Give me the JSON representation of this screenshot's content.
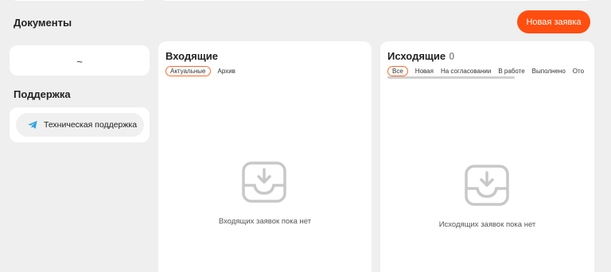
{
  "documents": {
    "title": "Документы",
    "value": "~"
  },
  "actions": {
    "new_request": "Новая заявка"
  },
  "support": {
    "title": "Поддержка",
    "button_label": "Техническая поддержка",
    "icon": "telegram-icon"
  },
  "incoming": {
    "title": "Входящие",
    "tabs": [
      "Актуальные",
      "Архив"
    ],
    "empty_text": "Входящих заявок пока нет"
  },
  "outgoing": {
    "title": "Исходящие",
    "count": "0",
    "tabs": [
      "Все",
      "Новая",
      "На согласовании",
      "В работе",
      "Выполнено",
      "Отo"
    ],
    "empty_text": "Исходящих заявок пока нет"
  },
  "colors": {
    "accent": "#ff4e0f",
    "telegram": "#2aa3df",
    "icon_gray": "#c8c8c8"
  }
}
